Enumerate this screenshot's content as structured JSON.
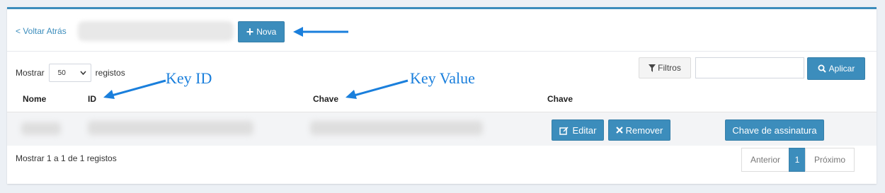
{
  "header": {
    "back_link": "< Voltar Atrás",
    "new_button": "Nova"
  },
  "controls": {
    "show_prefix": "Mostrar",
    "page_length": "50",
    "show_suffix": "registos",
    "filters_button": "Filtros",
    "search_value": "",
    "apply_button": "Aplicar"
  },
  "annotations": {
    "key_id": "Key ID",
    "key_value": "Key Value"
  },
  "table": {
    "columns": [
      "Nome",
      "ID",
      "Chave",
      "Chave"
    ],
    "rows": [
      {
        "nome": "",
        "id": "",
        "chave": "",
        "actions": {
          "edit": "Editar",
          "remove": "Remover",
          "signature_key": "Chave de assinatura"
        }
      }
    ]
  },
  "footer": {
    "info": "Mostrar 1 a 1 de 1 registos",
    "pagination": {
      "previous": "Anterior",
      "current": "1",
      "next": "Próximo"
    }
  },
  "colors": {
    "primary": "#3c8dbc",
    "annotation_blue": "#1a7fdc"
  },
  "icons": [
    "plus-icon",
    "chevron-down-icon",
    "filter-icon",
    "search-icon",
    "edit-icon",
    "times-icon",
    "arrow-icon"
  ]
}
